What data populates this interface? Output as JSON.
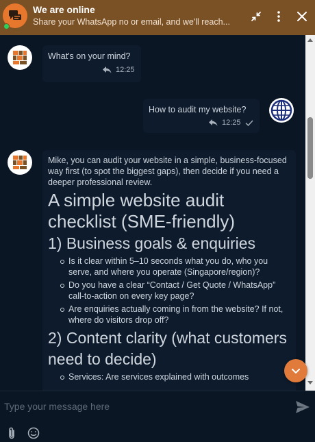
{
  "header": {
    "title": "We are online",
    "subtitle": "Share your WhatsApp no or email, and we'll reach...",
    "logo_icon": "chat-bubbles-icon",
    "actions": [
      "collapse-icon",
      "more-vertical-icon",
      "close-icon"
    ],
    "brand_color": "#7a5025",
    "status_color": "#2bd15a"
  },
  "messages": [
    {
      "from": "bot",
      "text": "What's on your mind?",
      "time": "12:25"
    },
    {
      "from": "user",
      "text": "How to audit my website?",
      "time": "12:25"
    },
    {
      "from": "bot",
      "intro": "Mike, you can audit your website in a simple, business-focused way first (to spot the biggest gaps), then decide if you need a deeper professional review.",
      "heading": "A simple website audit checklist (SME-friendly)",
      "sections": [
        {
          "title": "1) Business goals & enquiries",
          "items": [
            "Is it clear within 5–10 seconds what you do, who you serve, and where you operate (Singapore/region)?",
            "Do you have a clear “Contact / Get Quote / WhatsApp” call-to-action on every key page?",
            "Are enquiries actually coming in from the website? If not, where do visitors drop off?"
          ]
        },
        {
          "title": "2) Content clarity (what customers need to decide)",
          "items": [
            "Services: Are services explained with outcomes"
          ]
        }
      ]
    }
  ],
  "composer": {
    "placeholder": "Type your message here",
    "value": "",
    "tools": [
      "paperclip-icon",
      "emoji-icon"
    ],
    "send_icon": "send-icon"
  },
  "scroll_down_icon": "chevron-down-icon",
  "accent_color": "#e07b3c"
}
